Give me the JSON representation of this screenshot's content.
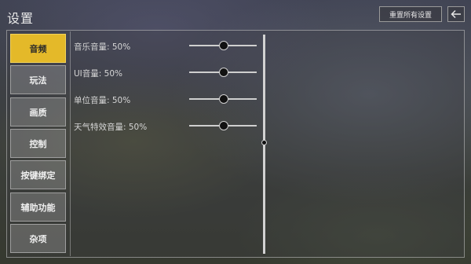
{
  "window": {
    "title": "设置"
  },
  "header": {
    "reset_label": "重置所有设置",
    "back_icon": "arrow-left-icon"
  },
  "sidebar": {
    "items": [
      {
        "label": "音频",
        "active": true
      },
      {
        "label": "玩法",
        "active": false
      },
      {
        "label": "画质",
        "active": false
      },
      {
        "label": "控制",
        "active": false
      },
      {
        "label": "按键绑定",
        "active": false
      },
      {
        "label": "辅助功能",
        "active": false
      },
      {
        "label": "杂项",
        "active": false
      }
    ]
  },
  "audio": {
    "settings": [
      {
        "label": "音乐音量: 50%",
        "value": 0.5
      },
      {
        "label": "UI音量: 50%",
        "value": 0.5
      },
      {
        "label": "单位音量: 50%",
        "value": 0.5
      },
      {
        "label": "天气特效音量: 50%",
        "value": 0.5
      }
    ]
  },
  "colors": {
    "accent": "#e4b929"
  }
}
